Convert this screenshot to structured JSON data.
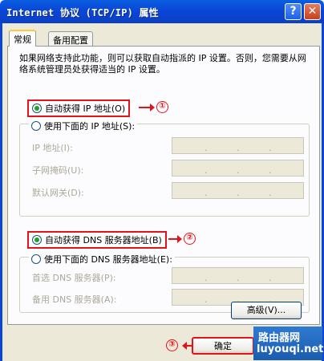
{
  "window": {
    "title": "Internet 协议 (TCP/IP) 属性",
    "help_glyph": "?",
    "close_glyph": "✕"
  },
  "tabs": [
    {
      "label": "常规",
      "active": true
    },
    {
      "label": "备用配置",
      "active": false
    }
  ],
  "intro_text": "如果网络支持此功能，则可以获取自动指派的 IP 设置。否则，您需要从网络系统管理员处获得适当的 IP 设置。",
  "ip_section": {
    "auto_label": "自动获得 IP 地址(O)",
    "manual_label": "使用下面的 IP 地址(S):",
    "auto_selected": true,
    "fields": [
      {
        "label": "IP 地址(I):",
        "value": ""
      },
      {
        "label": "子网掩码(U):",
        "value": ""
      },
      {
        "label": "默认网关(D):",
        "value": ""
      }
    ]
  },
  "dns_section": {
    "auto_label": "自动获得 DNS 服务器地址(B)",
    "manual_label": "使用下面的 DNS 服务器地址(E):",
    "auto_selected": true,
    "fields": [
      {
        "label": "首选 DNS 服务器(P):",
        "value": ""
      },
      {
        "label": "备用 DNS 服务器(A):",
        "value": ""
      }
    ]
  },
  "annotations": [
    "①",
    "②",
    "③"
  ],
  "buttons": {
    "advanced": "高级(V)...",
    "ok": "确定"
  },
  "watermark": {
    "line1": "路由器网",
    "line2": "luyouqi.net"
  },
  "colors": {
    "titlebar": "#0a46d8",
    "annotation_red": "#e0141a",
    "dialog_bg": "#ece9d8"
  }
}
